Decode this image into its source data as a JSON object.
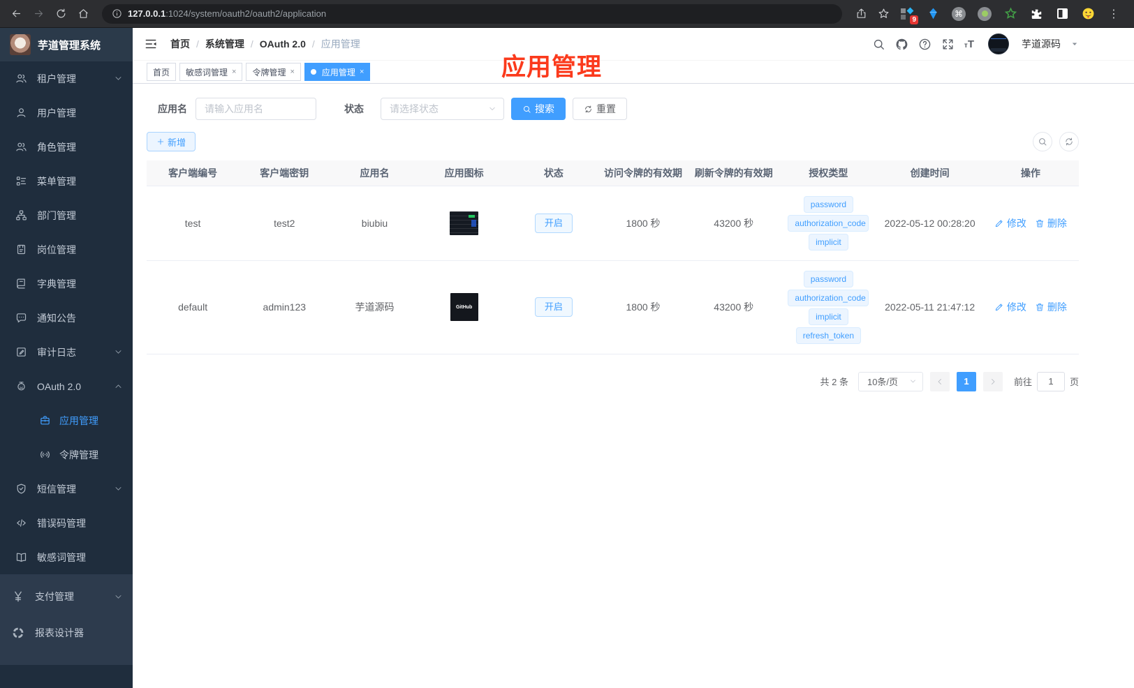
{
  "browser": {
    "url_host": "127.0.0.1",
    "url_rest": ":1024/system/oauth2/oauth2/application",
    "extension_badge": "9"
  },
  "sidebar": {
    "logo_title": "芋道管理系统",
    "items": [
      {
        "id": "tenant",
        "label": "租户管理",
        "icon": "tenant-users-icon",
        "arrow": "down"
      },
      {
        "id": "user",
        "label": "用户管理",
        "icon": "user-icon"
      },
      {
        "id": "role",
        "label": "角色管理",
        "icon": "roles-icon"
      },
      {
        "id": "menu",
        "label": "菜单管理",
        "icon": "menu-tree-icon"
      },
      {
        "id": "dept",
        "label": "部门管理",
        "icon": "dept-icon"
      },
      {
        "id": "post",
        "label": "岗位管理",
        "icon": "post-icon"
      },
      {
        "id": "dict",
        "label": "字典管理",
        "icon": "dict-icon"
      },
      {
        "id": "notice",
        "label": "通知公告",
        "icon": "notice-icon"
      },
      {
        "id": "audit",
        "label": "审计日志",
        "icon": "audit-log-icon",
        "arrow": "down"
      },
      {
        "id": "oauth2",
        "label": "OAuth 2.0",
        "icon": "oauth-robot-icon",
        "arrow": "up",
        "children": [
          {
            "id": "oauth2-app",
            "label": "应用管理",
            "icon": "briefcase-icon",
            "active": true
          },
          {
            "id": "oauth2-token",
            "label": "令牌管理",
            "icon": "token-signal-icon"
          }
        ]
      },
      {
        "id": "sms",
        "label": "短信管理",
        "icon": "shield-check-icon",
        "arrow": "down"
      },
      {
        "id": "errcode",
        "label": "错误码管理",
        "icon": "code-icon"
      },
      {
        "id": "sensitive",
        "label": "敏感词管理",
        "icon": "open-book-icon"
      },
      {
        "id": "pay",
        "label": "支付管理",
        "icon": "yen-icon",
        "arrow": "down",
        "section": "bottom"
      },
      {
        "id": "report",
        "label": "报表设计器",
        "icon": "report-circle-icon",
        "section": "bottom"
      }
    ]
  },
  "header": {
    "breadcrumb": [
      "首页",
      "系统管理",
      "OAuth 2.0",
      "应用管理"
    ],
    "username": "芋道源码"
  },
  "tabs": [
    {
      "label": "首页",
      "closable": false,
      "active": false
    },
    {
      "label": "敏感词管理",
      "closable": true,
      "active": false
    },
    {
      "label": "令牌管理",
      "closable": true,
      "active": false
    },
    {
      "label": "应用管理",
      "closable": true,
      "active": true
    }
  ],
  "annotation": {
    "text": "应用管理",
    "color": "#fb3a1c"
  },
  "filters": {
    "app_name_label": "应用名",
    "app_name_placeholder": "请输入应用名",
    "status_label": "状态",
    "status_placeholder": "请选择状态",
    "search_label": "搜索",
    "reset_label": "重置"
  },
  "toolbar": {
    "add_label": "新增"
  },
  "table": {
    "columns": [
      "客户端编号",
      "客户端密钥",
      "应用名",
      "应用图标",
      "状态",
      "访问令牌的有效期",
      "刷新令牌的有效期",
      "授权类型",
      "创建时间",
      "操作"
    ],
    "edit_label": "修改",
    "delete_label": "删除",
    "rows": [
      {
        "client_id": "test",
        "secret": "test2",
        "name": "biubiu",
        "app_icon": "dark-dashboard-thumbnail",
        "status": "开启",
        "access_ttl": "1800 秒",
        "refresh_ttl": "43200 秒",
        "grant_types": [
          "password",
          "authorization_code",
          "implicit"
        ],
        "created": "2022-05-12 00:28:20"
      },
      {
        "client_id": "default",
        "secret": "admin123",
        "name": "芋道源码",
        "app_icon": "dark-github-logo",
        "app_icon_text": "GitHub",
        "status": "开启",
        "access_ttl": "1800 秒",
        "refresh_ttl": "43200 秒",
        "grant_types": [
          "password",
          "authorization_code",
          "implicit",
          "refresh_token"
        ],
        "created": "2022-05-11 21:47:12"
      }
    ]
  },
  "pagination": {
    "total_text": "共 2 条",
    "page_size": "10条/页",
    "current_page": "1",
    "goto_label": "前往",
    "goto_value": "1",
    "page_suffix": "页"
  }
}
